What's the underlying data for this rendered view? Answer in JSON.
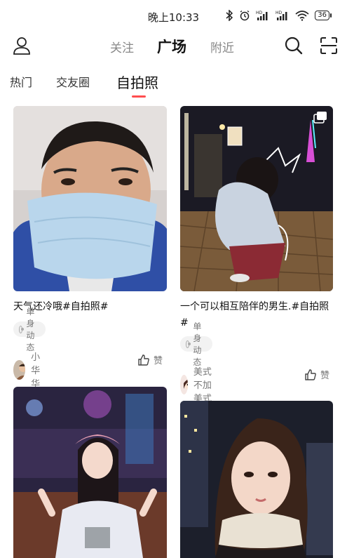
{
  "status_bar": {
    "time": "晚上10:33",
    "battery": "36",
    "icons": [
      "bluetooth-icon",
      "alarm-icon",
      "signal-icon",
      "signal-icon",
      "wifi-icon",
      "battery-icon"
    ]
  },
  "header": {
    "tabs": [
      {
        "label": "关注",
        "active": false
      },
      {
        "label": "广场",
        "active": true
      },
      {
        "label": "附近",
        "active": false
      }
    ],
    "left_icon": "user-icon",
    "right_icons": [
      "search-icon",
      "scan-icon"
    ]
  },
  "subtabs": [
    {
      "label": "热门",
      "active": false
    },
    {
      "label": "交友圈",
      "active": false
    },
    {
      "label": "自拍照",
      "active": true
    }
  ],
  "colors": {
    "accent": "#ff4d4f",
    "tag_bg": "#f2f2f2",
    "muted": "#777777"
  },
  "feed": {
    "left": [
      {
        "title": "天气还冷哦#自拍照#",
        "tag": "单身动态",
        "author": "小华华",
        "like_label": "赞",
        "photo": "selfie-man-mask"
      },
      {
        "photo": "girl-pink-hat"
      }
    ],
    "right": [
      {
        "title": "一个可以相互陪伴的男生.#自拍照#",
        "tag": "单身动态",
        "author": "美式不加美式",
        "like_label": "赞",
        "photo": "girl-night-tower",
        "badge": "multi-image-icon"
      },
      {
        "photo": "girl-scarf-night"
      }
    ]
  }
}
